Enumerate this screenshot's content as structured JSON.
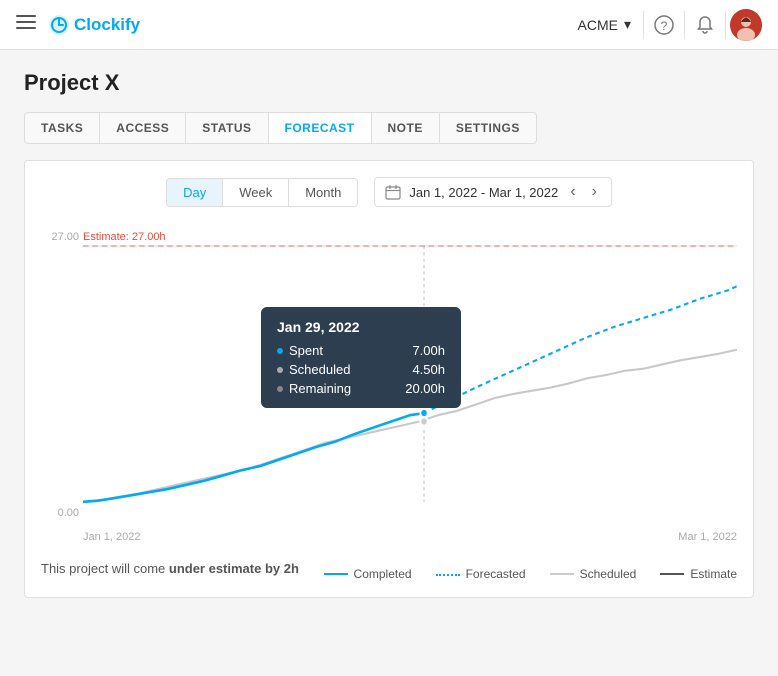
{
  "header": {
    "menu_icon": "☰",
    "logo_text": "Clockify",
    "acme_label": "ACME",
    "chevron": "▾",
    "help_icon": "?",
    "bell_icon": "🔔"
  },
  "page": {
    "title": "Project X"
  },
  "tabs": [
    {
      "id": "tasks",
      "label": "TASKS",
      "active": false
    },
    {
      "id": "access",
      "label": "ACCESS",
      "active": false
    },
    {
      "id": "status",
      "label": "STATUS",
      "active": false
    },
    {
      "id": "forecast",
      "label": "FORECAST",
      "active": true
    },
    {
      "id": "note",
      "label": "NOTE",
      "active": false
    },
    {
      "id": "settings",
      "label": "SETTINGS",
      "active": false
    }
  ],
  "chart": {
    "view_buttons": [
      {
        "label": "Day",
        "active": true
      },
      {
        "label": "Week",
        "active": false
      },
      {
        "label": "Month",
        "active": false
      }
    ],
    "date_range": "Jan 1, 2022 - Mar 1, 2022",
    "estimate_label": "Estimate: 27.00h",
    "y_max": "27.00",
    "y_min": "0.00",
    "x_start": "Jan 1, 2022",
    "x_end": "Mar 1, 2022",
    "tooltip": {
      "date": "Jan 29, 2022",
      "rows": [
        {
          "label": "Spent",
          "value": "7.00h",
          "color": "#03a9f4"
        },
        {
          "label": "Scheduled",
          "value": "4.50h",
          "color": "#bbb"
        },
        {
          "label": "Remaining",
          "value": "20.00h",
          "color": "#888"
        }
      ]
    }
  },
  "legend": [
    {
      "label": "Completed",
      "style": "solid",
      "color": "#03a9f4"
    },
    {
      "label": "Forecasted",
      "style": "dotted",
      "color": "#03a9f4"
    },
    {
      "label": "Scheduled",
      "style": "solid",
      "color": "#ccc"
    },
    {
      "label": "Estimate",
      "style": "solid",
      "color": "#555"
    }
  ],
  "bottom_note": {
    "prefix": "This project will come ",
    "highlight": "under estimate by 2h"
  }
}
